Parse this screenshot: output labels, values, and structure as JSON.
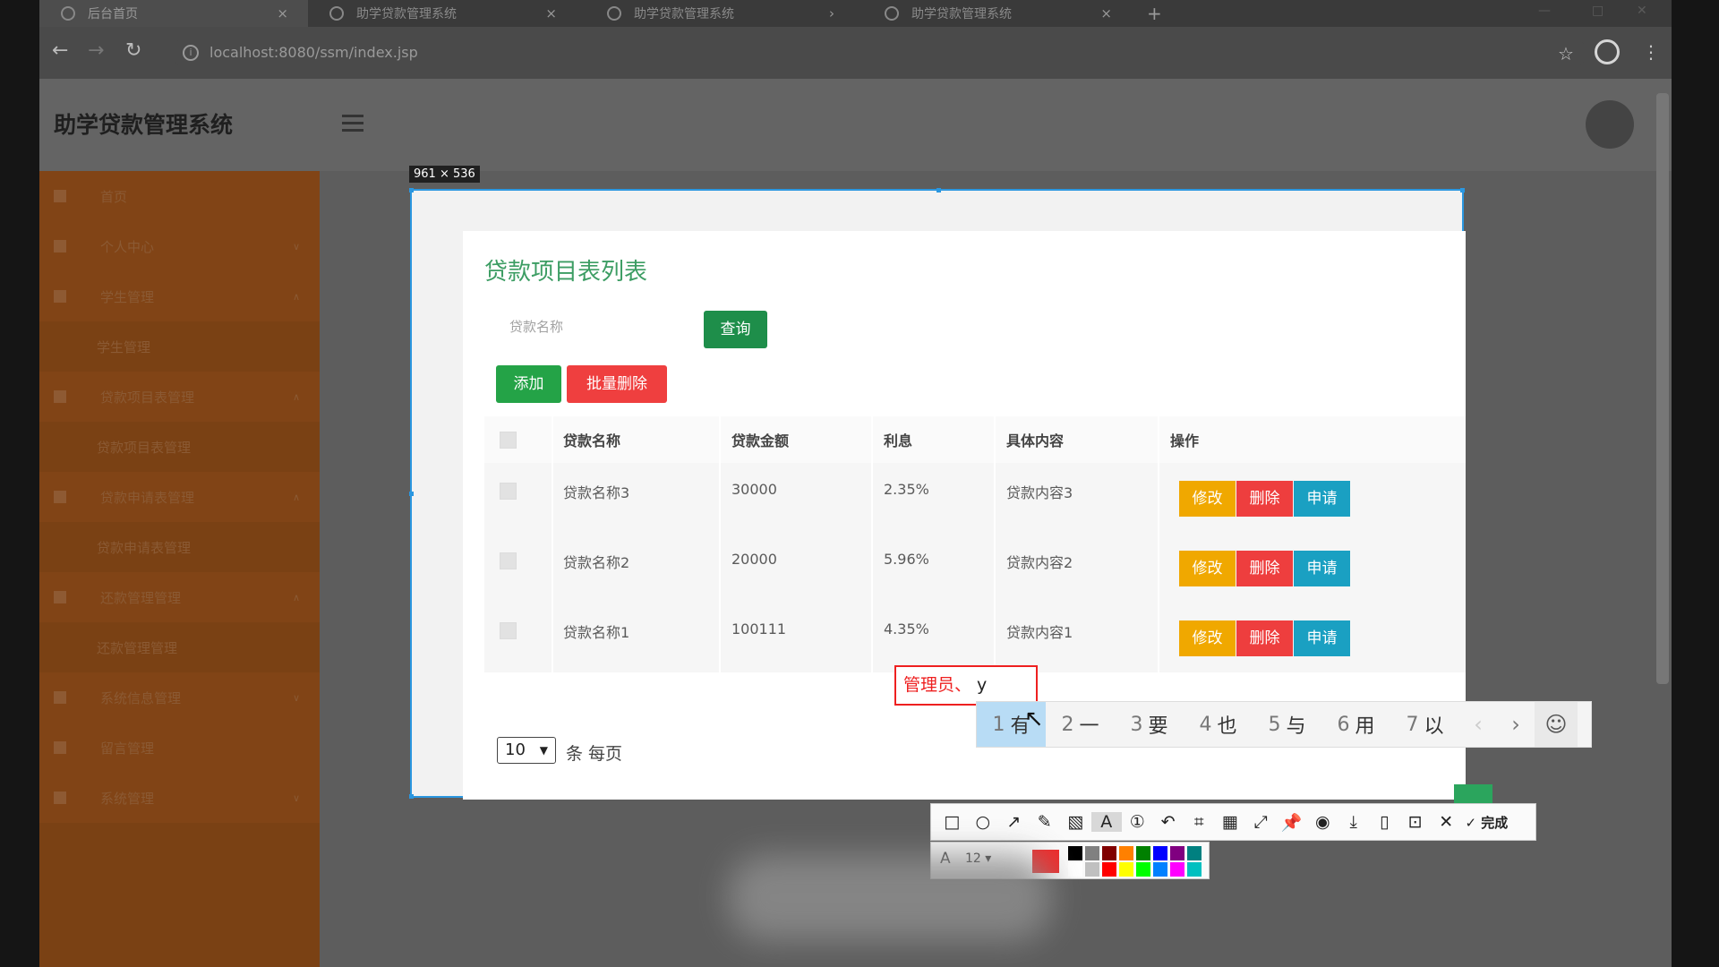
{
  "browser": {
    "tabs": [
      {
        "label": "后台首页",
        "active": true
      },
      {
        "label": "助学贷款管理系统",
        "active": false
      },
      {
        "label": "助学贷款管理系统",
        "active": false
      },
      {
        "label": "助学贷款管理系统",
        "active": false
      }
    ],
    "new_tab": "+",
    "url": "localhost:8080/ssm/index.jsp",
    "icons": {
      "back": "back-arrow-icon",
      "forward": "forward-arrow-icon",
      "reload": "reload-icon",
      "star": "star-icon",
      "profile": "profile-icon",
      "menu": "kebab-menu-icon"
    }
  },
  "app": {
    "title": "助学贷款管理系统",
    "sidebar": [
      {
        "label": "首页",
        "type": "top"
      },
      {
        "label": "个人中心",
        "type": "top"
      },
      {
        "label": "学生管理",
        "type": "top"
      },
      {
        "label": "学生管理",
        "type": "sub"
      },
      {
        "label": "贷款项目表管理",
        "type": "top"
      },
      {
        "label": "贷款项目表管理",
        "type": "sub"
      },
      {
        "label": "贷款申请表管理",
        "type": "top"
      },
      {
        "label": "贷款申请表管理",
        "type": "sub"
      },
      {
        "label": "还款管理管理",
        "type": "top"
      },
      {
        "label": "还款管理管理",
        "type": "sub"
      },
      {
        "label": "系统信息管理",
        "type": "top"
      },
      {
        "label": "留言管理",
        "type": "top"
      },
      {
        "label": "系统管理",
        "type": "top"
      }
    ]
  },
  "capture": {
    "size_label": "961 × 536",
    "accent": "#2b97e0"
  },
  "panel": {
    "title": "贷款项目表列表",
    "search_placeholder": "贷款名称",
    "query_btn": "查询",
    "add_btn": "添加",
    "batch_delete_btn": "批量删除",
    "columns": [
      "贷款名称",
      "贷款金额",
      "利息",
      "具体内容",
      "操作"
    ],
    "rows": [
      {
        "name": "贷款名称3",
        "amount": "30000",
        "interest": "2.35%",
        "content": "贷款内容3"
      },
      {
        "name": "贷款名称2",
        "amount": "20000",
        "interest": "5.96%",
        "content": "贷款内容2"
      },
      {
        "name": "贷款名称1",
        "amount": "100111",
        "interest": "4.35%",
        "content": "贷款内容1"
      }
    ],
    "row_actions": {
      "edit": "修改",
      "delete": "删除",
      "apply": "申请"
    },
    "page_size": "10",
    "page_size_label": "条 每页"
  },
  "annotation": {
    "text": "管理员、",
    "caret": "y",
    "color": "#ee2020"
  },
  "ime": {
    "candidates": [
      {
        "n": "1",
        "c": "有"
      },
      {
        "n": "2",
        "c": "一"
      },
      {
        "n": "3",
        "c": "要"
      },
      {
        "n": "4",
        "c": "也"
      },
      {
        "n": "5",
        "c": "与"
      },
      {
        "n": "6",
        "c": "用"
      },
      {
        "n": "7",
        "c": "以"
      }
    ],
    "prev": "‹",
    "next": "›",
    "emoji": "☺"
  },
  "toolbar": {
    "tools": [
      {
        "icon": "rectangle-icon",
        "glyph": "□"
      },
      {
        "icon": "ellipse-icon",
        "glyph": "○"
      },
      {
        "icon": "arrow-icon",
        "glyph": "↗"
      },
      {
        "icon": "pen-icon",
        "glyph": "✎"
      },
      {
        "icon": "mosaic-icon",
        "glyph": "▧"
      },
      {
        "icon": "text-icon",
        "glyph": "A"
      },
      {
        "icon": "number-icon",
        "glyph": "①"
      },
      {
        "icon": "undo-icon",
        "glyph": "↶"
      },
      {
        "icon": "crop-icon",
        "glyph": "⌗"
      },
      {
        "icon": "ocr-icon",
        "glyph": "▦"
      },
      {
        "icon": "expand-icon",
        "glyph": "⤢"
      },
      {
        "icon": "pin-icon",
        "glyph": "📌"
      },
      {
        "icon": "record-icon",
        "glyph": "◉"
      },
      {
        "icon": "download-icon",
        "glyph": "⤓"
      },
      {
        "icon": "save-icon",
        "glyph": "▯"
      },
      {
        "icon": "bookmark-icon",
        "glyph": "⊡"
      },
      {
        "icon": "close-icon",
        "glyph": "✕"
      }
    ],
    "done_label": "完成",
    "font_size": "12",
    "active_color": "#ee2a2a",
    "palette": [
      "#000000",
      "#808080",
      "#800000",
      "#ff8000",
      "#008000",
      "#0000ff",
      "#800080",
      "#008080",
      "#ffffff",
      "#c0c0c0",
      "#ff0000",
      "#ffff00",
      "#00ff00",
      "#0080ff",
      "#ff00ff",
      "#00c0c0"
    ]
  }
}
